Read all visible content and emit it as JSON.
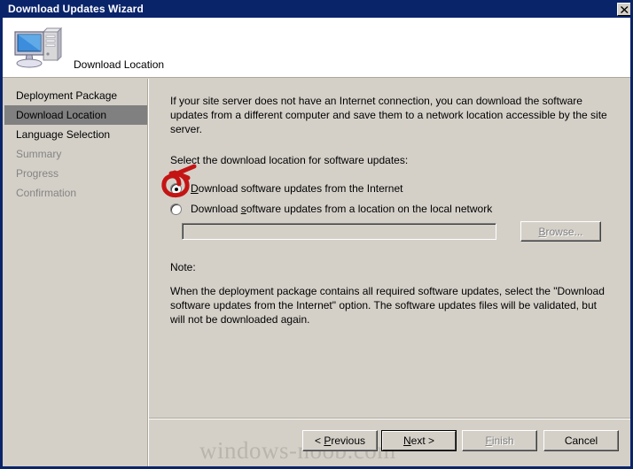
{
  "window": {
    "title": "Download Updates Wizard",
    "close_icon": "close-x-icon"
  },
  "header": {
    "icon": "computer-monitor-icon",
    "title": "Download Location"
  },
  "sidebar": {
    "items": [
      {
        "label": "Deployment Package",
        "state": "enabled"
      },
      {
        "label": "Download Location",
        "state": "selected"
      },
      {
        "label": "Language Selection",
        "state": "enabled"
      },
      {
        "label": "Summary",
        "state": "disabled"
      },
      {
        "label": "Progress",
        "state": "disabled"
      },
      {
        "label": "Confirmation",
        "state": "disabled"
      }
    ]
  },
  "content": {
    "intro": "If your site server does not have an Internet connection, you can download the software updates from a different computer and save them to a network location accessible by the site server.",
    "select_label": "Select the download location for software updates:",
    "radio_internet": {
      "label_pre": "",
      "label_accel": "D",
      "label_post": "ownload software updates from the Internet",
      "label_full": "Download software updates from the Internet",
      "selected": true
    },
    "radio_local": {
      "label_pre": "Download ",
      "label_accel": "s",
      "label_post": "oftware updates from a location on the local network",
      "label_full": "Download software updates from a location on the local network",
      "selected": false
    },
    "path_value": "",
    "path_placeholder": "",
    "browse_label_accel": "B",
    "browse_label_post": "rowse...",
    "browse_label_full": "Browse...",
    "browse_enabled": false,
    "note_label": "Note:",
    "note_body": "When the deployment package contains all required software updates, select the \"Download software updates from the Internet\" option. The software updates files will be validated, but will not be downloaded again."
  },
  "footer": {
    "previous": {
      "label_full": "< Previous",
      "pre": "< ",
      "accel": "P",
      "post": "revious",
      "enabled": true
    },
    "next": {
      "label_full": "Next >",
      "pre": "",
      "accel": "N",
      "post": "ext >",
      "enabled": true,
      "is_default": true
    },
    "finish": {
      "label_full": "Finish",
      "pre": "",
      "accel": "F",
      "post": "inish",
      "enabled": false
    },
    "cancel": {
      "label_full": "Cancel",
      "pre": "",
      "accel": "",
      "post": "Cancel",
      "enabled": true
    }
  },
  "watermark": {
    "text": "windows-noob.com"
  },
  "annotation": {
    "type": "hand-drawn-red-circle",
    "color": "#c41414",
    "target": "radio-internet"
  },
  "colors": {
    "titlebar": "#0a246a",
    "dialog_face": "#d4d0c8",
    "selection": "#808080",
    "disabled_text": "#848484",
    "annotation_red": "#c41414",
    "watermark_gray": "#b9b5ad"
  }
}
